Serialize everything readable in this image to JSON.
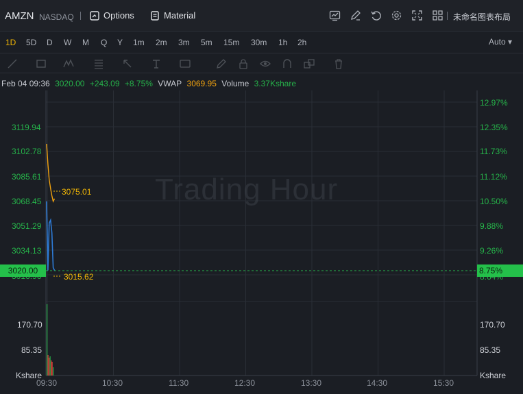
{
  "header": {
    "symbol": "AMZN",
    "exchange": "NASDAQ",
    "options_label": "Options",
    "material_label": "Material",
    "layout_label": "未命名图表布局"
  },
  "intervals": {
    "items": [
      "1D",
      "5D",
      "D",
      "W",
      "M",
      "Q",
      "Y",
      "1m",
      "2m",
      "3m",
      "5m",
      "15m",
      "30m",
      "1h",
      "2h"
    ],
    "active": "1D",
    "scale_mode": "Auto"
  },
  "info": {
    "datetime": "Feb 04 09:36",
    "price": "3020.00",
    "change": "+243.09",
    "change_pct": "+8.75%",
    "vwap_label": "VWAP",
    "vwap_value": "3069.95",
    "volume_label": "Volume",
    "volume_value": "3.37Kshare"
  },
  "colors": {
    "up": "#26b34a",
    "vwap": "#f2a30f",
    "price_line": "#2e7bd6",
    "background": "#1b1e24"
  },
  "watermark": "Trading Hour",
  "chart_data": {
    "type": "line",
    "y_left_ticks": [
      "3119.94",
      "3102.78",
      "3085.61",
      "3068.45",
      "3051.29",
      "3034.13",
      "3016.96"
    ],
    "y_right_ticks": [
      "12.97%",
      "12.35%",
      "11.73%",
      "11.12%",
      "10.50%",
      "9.88%",
      "9.26%",
      "8.64%"
    ],
    "x_ticks": [
      "09:30",
      "10:30",
      "11:30",
      "12:30",
      "13:30",
      "14:30",
      "15:30"
    ],
    "current_price_label": "3020.00",
    "current_pct_label": "8.75%",
    "annotation_high": "3075.01",
    "annotation_low": "3015.62",
    "volume_ticks": [
      "170.70",
      "85.35"
    ],
    "volume_unit": "Kshare",
    "ylim": [
      3000,
      3137
    ],
    "series": [
      {
        "x": [
          "09:30",
          "09:31",
          "09:32",
          "09:33",
          "09:34",
          "09:35",
          "09:36"
        ],
        "values": [
          3068,
          3020,
          3053,
          3055,
          3046,
          3022,
          3020
        ]
      },
      {
        "x": [
          "09:30",
          "09:31",
          "09:32",
          "09:33",
          "09:34",
          "09:35",
          "09:36"
        ],
        "values": [
          3108,
          3094,
          3083,
          3077,
          3072,
          3068,
          3069.95
        ]
      }
    ]
  }
}
